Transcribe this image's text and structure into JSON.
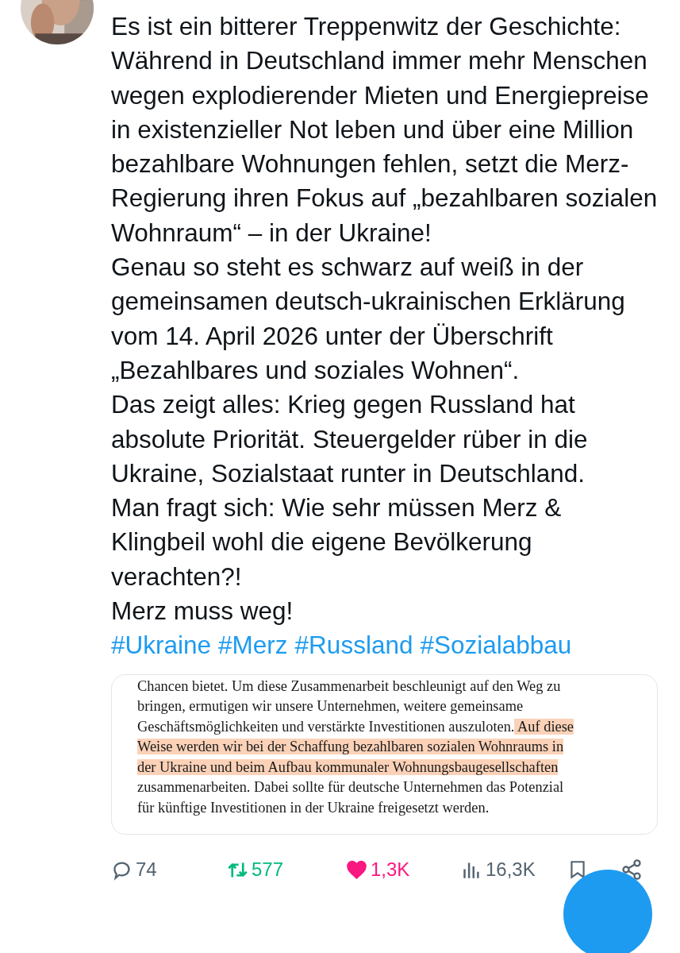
{
  "post": {
    "paragraphs": [
      "Es ist ein bitterer Treppenwitz der Geschichte: Während in Deutschland immer mehr Menschen wegen explodierender Mieten und Energiepreise in existenzieller Not leben und über eine Million bezahlbare Wohnungen fehlen, setzt die Merz-Regierung ihren Fokus auf „bezahlbaren sozialen Wohnraum“ – in der Ukraine!",
      "Genau so steht es schwarz auf weiß in der gemeinsamen deutsch-ukrainischen Erklärung vom 14. April 2026 unter der Überschrift „Bezahlbares und soziales Wohnen“.",
      "Das zeigt alles: Krieg gegen Russland hat absolute Priorität. Steuergelder rüber in die Ukraine, Sozialstaat runter in Deutschland.",
      "Man fragt sich: Wie sehr müssen Merz & Klingbeil wohl die eigene Bevölkerung verachten?!",
      "Merz muss weg!"
    ],
    "hashtags": [
      "#Ukraine",
      "#Merz",
      "#Russland",
      "#Sozialabbau"
    ]
  },
  "document": {
    "lines": [
      [
        {
          "text": "Chancen bietet. Um diese Zusammenarbeit beschleunigt auf den Weg zu",
          "highlighted": false
        }
      ],
      [
        {
          "text": "bringen, ermutigen wir unsere Unternehmen, weitere gemeinsame",
          "highlighted": false
        }
      ],
      [
        {
          "text": "Geschäftsmöglichkeiten und verstärkte Investitionen auszuloten.",
          "highlighted": false
        },
        {
          "text": " Auf diese",
          "highlighted": true
        }
      ],
      [
        {
          "text": "Weise werden wir bei der Schaffung bezahlbaren sozialen Wohnraums in",
          "highlighted": true
        }
      ],
      [
        {
          "text": "der Ukraine und beim Aufbau kommunaler Wohnungsbaugesellschaften",
          "highlighted": true
        }
      ],
      [
        {
          "text": "zusammenarbeiten. Dabei sollte für deutsche Unternehmen das Potenzial",
          "highlighted": false
        }
      ],
      [
        {
          "text": "für künftige Investitionen in der Ukraine freigesetzt werden.",
          "highlighted": false
        }
      ]
    ]
  },
  "actions": [
    {
      "kind": "reply",
      "count": "74",
      "active": false
    },
    {
      "kind": "repost",
      "count": "577",
      "active": true
    },
    {
      "kind": "like",
      "count": "1,3K",
      "active": true
    },
    {
      "kind": "views",
      "count": "16,3K",
      "active": false
    }
  ]
}
